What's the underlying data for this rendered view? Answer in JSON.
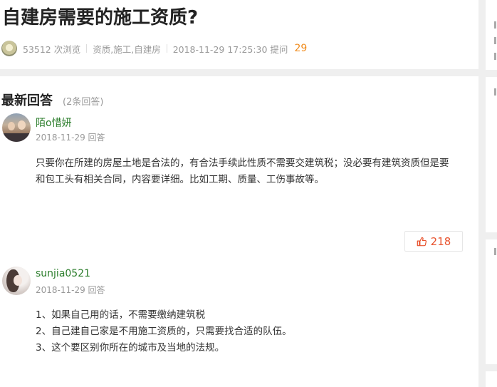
{
  "question": {
    "title": "自建房需要的施工资质?",
    "views": "53512 次浏览",
    "tags": "资质,施工,自建房",
    "timestamp": "2018-11-29 17:25:30 提问",
    "answer_count": "29"
  },
  "answers_section": {
    "heading": "最新回答",
    "count_label": "(2条回答)"
  },
  "answers": [
    {
      "username": "陌o惜妍",
      "date": "2018-11-29 回答",
      "lines": [
        "只要你在所建的房屋土地是合法的，有合法手续此性质不需要交建筑税；没必要有建筑资质但是要",
        "和包工头有相关合同，内容要详细。比如工期、质量、工伤事故等。"
      ],
      "likes": "218"
    },
    {
      "username": "sunjia0521",
      "date": "2018-11-29 回答",
      "lines": [
        "1、如果自己用的话，不需要缴纳建筑税",
        "2、自己建自己家是不用施工资质的，只需要找合适的队伍。",
        "3、这个要区别你所在的城市及当地的法规。"
      ]
    }
  ],
  "colors": {
    "accent_orange": "#f08c1e",
    "username_green": "#2b7d2b",
    "like_red": "#e8532e"
  }
}
